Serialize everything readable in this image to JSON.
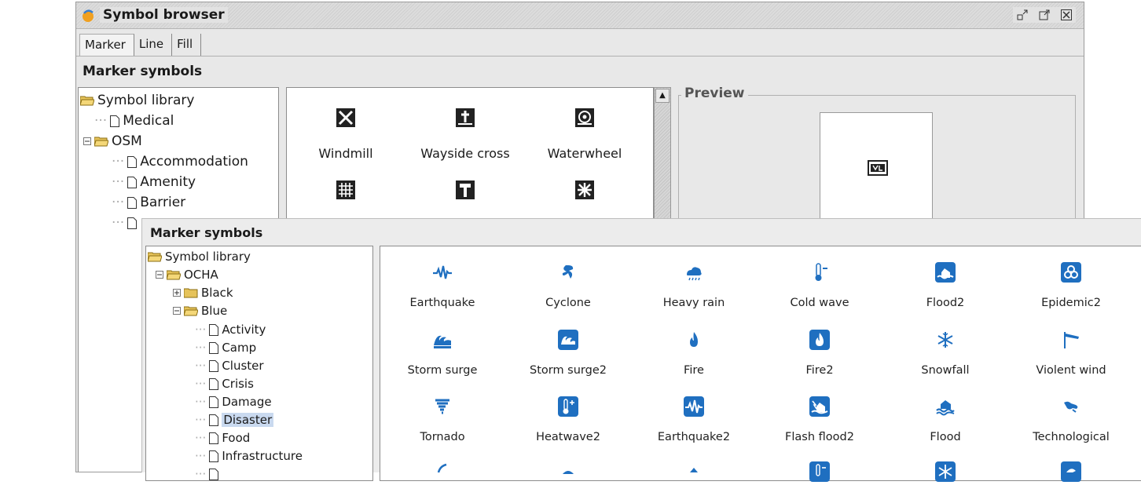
{
  "window": {
    "title": "Symbol browser",
    "tabs": [
      "Marker",
      "Line",
      "Fill"
    ],
    "section_title": "Marker symbols",
    "preview_label": "Preview"
  },
  "back_tree": {
    "root": "Symbol library",
    "items": [
      "Medical",
      "OSM",
      "Accommodation",
      "Amenity",
      "Barrier"
    ]
  },
  "back_grid": {
    "row1": [
      "Windmill",
      "Wayside cross",
      "Waterwheel"
    ]
  },
  "front": {
    "section_title": "Marker symbols",
    "tree": {
      "root": "Symbol library",
      "ocha": "OCHA",
      "black": "Black",
      "blue": "Blue",
      "children": [
        "Activity",
        "Camp",
        "Cluster",
        "Crisis",
        "Damage",
        "Disaster",
        "Food",
        "Infrastructure"
      ],
      "selected": "Disaster"
    },
    "grid": {
      "row1": [
        "Earthquake",
        "Cyclone",
        "Heavy rain",
        "Cold wave",
        "Flood2",
        "Epidemic2"
      ],
      "row2": [
        "Storm surge",
        "Storm surge2",
        "Fire",
        "Fire2",
        "Snowfall",
        "Violent wind"
      ],
      "row3": [
        "Tornado",
        "Heatwave2",
        "Earthquake2",
        "Flash flood2",
        "Flood",
        "Technological"
      ]
    }
  },
  "colors": {
    "ocha_blue": "#1f6fc0",
    "selection": "#c9d9ef"
  }
}
